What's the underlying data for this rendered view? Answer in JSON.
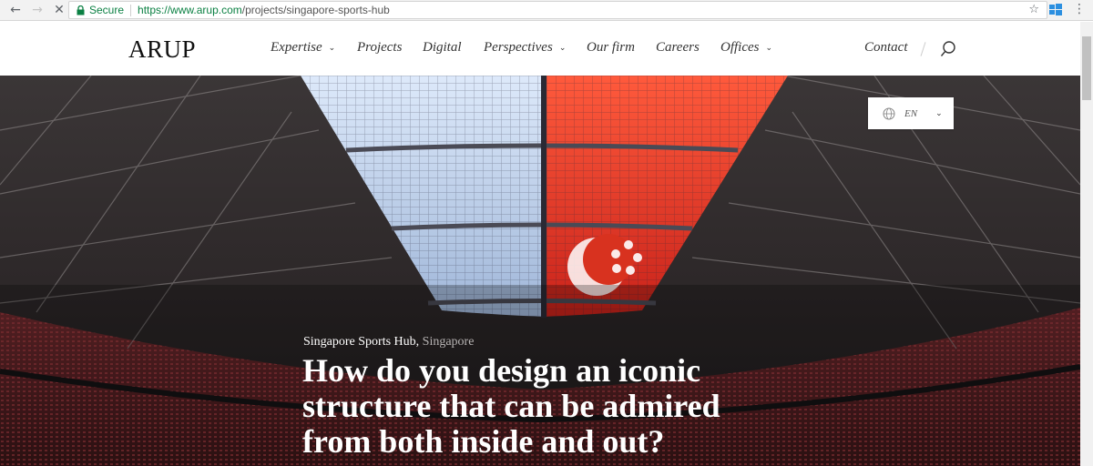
{
  "browser": {
    "secure_label": "Secure",
    "url_host": "https://www.arup.com",
    "url_path": "/projects/singapore-sports-hub"
  },
  "header": {
    "logo": "ARUP",
    "nav": [
      {
        "label": "Expertise",
        "has_dropdown": true
      },
      {
        "label": "Projects",
        "has_dropdown": false
      },
      {
        "label": "Digital",
        "has_dropdown": false
      },
      {
        "label": "Perspectives",
        "has_dropdown": true
      },
      {
        "label": "Our firm",
        "has_dropdown": false
      },
      {
        "label": "Careers",
        "has_dropdown": false
      },
      {
        "label": "Offices",
        "has_dropdown": true
      }
    ],
    "contact": "Contact"
  },
  "hero": {
    "language": "EN",
    "project_name": "Singapore Sports Hub,",
    "location": "Singapore",
    "title": "How do you design an iconic structure that can be admired from both inside and out?"
  },
  "icons": {
    "back": "arrow-left-icon",
    "forward": "arrow-right-icon",
    "stop": "close-icon",
    "lock": "lock-icon",
    "star": "star-icon",
    "menu": "kebab-menu-icon",
    "search": "search-icon",
    "globe": "globe-icon"
  },
  "colors": {
    "secure_green": "#0b8043",
    "roof_red": "#e0321f",
    "roof_blue": "#cfe0f7"
  }
}
